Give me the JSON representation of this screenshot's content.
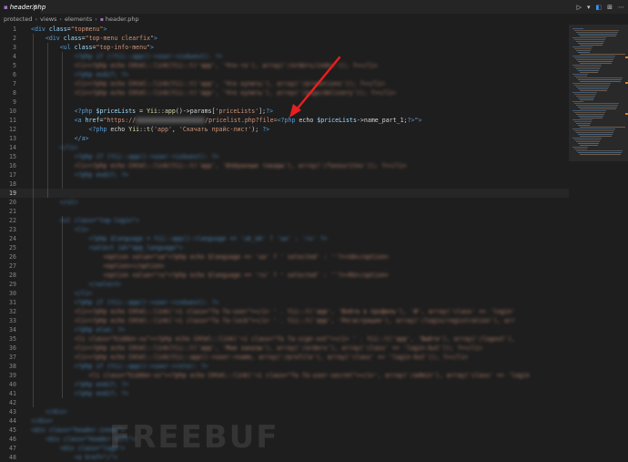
{
  "tab": {
    "icon": "php-elephant-icon",
    "title": "header.php",
    "close": "×"
  },
  "actions": [
    "▷",
    "▾",
    "◧",
    "⊞",
    "⋯"
  ],
  "breadcrumbs": {
    "items": [
      "protected",
      "views",
      "elements",
      "header.php"
    ],
    "separator": "›"
  },
  "lines": [
    {
      "n": "1",
      "code": [
        [
          "t-tag",
          "<div "
        ],
        [
          "t-attr",
          "class"
        ],
        [
          "t-plain",
          "="
        ],
        [
          "t-str",
          "\"topmenu\""
        ],
        [
          "t-tag",
          ">"
        ]
      ]
    },
    {
      "n": "2",
      "code": [
        [
          "t-plain",
          "    "
        ],
        [
          "t-tag",
          "<div "
        ],
        [
          "t-attr",
          "class"
        ],
        [
          "t-plain",
          "="
        ],
        [
          "t-str",
          "\"top-menu clearfix\""
        ],
        [
          "t-tag",
          ">"
        ]
      ]
    },
    {
      "n": "3",
      "code": [
        [
          "t-plain",
          "        "
        ],
        [
          "t-tag",
          "<ul "
        ],
        [
          "t-attr",
          "class"
        ],
        [
          "t-plain",
          "="
        ],
        [
          "t-str",
          "\"top-info-menu\""
        ],
        [
          "t-tag",
          ">"
        ]
      ]
    },
    {
      "n": "4",
      "blur": true,
      "code": [
        [
          "t-plain",
          "            "
        ],
        [
          "t-php",
          "<?php if (!Yii::app()->user->isGuest): ?>"
        ]
      ]
    },
    {
      "n": "5",
      "blur": true,
      "code": [
        [
          "t-plain",
          "            "
        ],
        [
          "t-str",
          "<li><?php echo CHtml::link(Yii::t('app', 'Что-то'), array('/orders/index')); ?></li>"
        ]
      ]
    },
    {
      "n": "6",
      "blur": true,
      "code": [
        [
          "t-plain",
          "            "
        ],
        [
          "t-php",
          "<?php endif; ?>"
        ]
      ]
    },
    {
      "n": "7",
      "blur": true,
      "code": [
        [
          "t-plain",
          "            "
        ],
        [
          "t-str",
          "<li><?php echo CHtml::link(Yii::t('app', 'Что купить'), array('/promotions')); ?></li>"
        ]
      ]
    },
    {
      "n": "8",
      "blur": true,
      "code": [
        [
          "t-plain",
          "            "
        ],
        [
          "t-str",
          "<li><?php echo CHtml::link(Yii::t('app', 'Что купить'), array('/page/delivery')); ?></li>"
        ]
      ]
    },
    {
      "n": "9",
      "code": []
    },
    {
      "n": "10",
      "code": [
        [
          "t-plain",
          "            "
        ],
        [
          "t-php",
          "<?php "
        ],
        [
          "t-var",
          "$priceLists"
        ],
        [
          "t-plain",
          " = "
        ],
        [
          "t-fn",
          "Yii"
        ],
        [
          "t-plain",
          "::"
        ],
        [
          "t-fn",
          "app"
        ],
        [
          "t-plain",
          "()->params["
        ],
        [
          "t-str",
          "'priceLists'"
        ],
        [
          "t-plain",
          "];"
        ],
        [
          "t-php",
          "?>"
        ]
      ]
    },
    {
      "n": "11",
      "code": [
        [
          "t-plain",
          "            "
        ],
        [
          "t-tag",
          "<a "
        ],
        [
          "t-attr",
          "href"
        ],
        [
          "t-plain",
          "="
        ],
        [
          "t-str",
          "\"https://"
        ],
        [
          "mask",
          "                       "
        ],
        [
          "t-str",
          "/pricelist.php?file="
        ],
        [
          "t-php",
          "<?php "
        ],
        [
          "t-plain",
          "echo "
        ],
        [
          "t-var",
          "$priceLists"
        ],
        [
          "t-plain",
          "->name_part_1;"
        ],
        [
          "t-php",
          "?>"
        ],
        [
          "t-str",
          "\""
        ],
        [
          "t-tag",
          ">"
        ]
      ]
    },
    {
      "n": "12",
      "code": [
        [
          "t-plain",
          "                "
        ],
        [
          "t-php",
          "<?php "
        ],
        [
          "t-plain",
          "echo "
        ],
        [
          "t-fn",
          "Yii"
        ],
        [
          "t-plain",
          "::"
        ],
        [
          "t-fn",
          "t"
        ],
        [
          "t-plain",
          "("
        ],
        [
          "t-str",
          "'app'"
        ],
        [
          "t-plain",
          ", "
        ],
        [
          "t-str",
          "'Скачать прайс-лист'"
        ],
        [
          "t-plain",
          "); "
        ],
        [
          "t-php",
          "?>"
        ]
      ]
    },
    {
      "n": "13",
      "code": [
        [
          "t-plain",
          "            "
        ],
        [
          "t-tag",
          "</a>"
        ]
      ]
    },
    {
      "n": "14",
      "blur": true,
      "code": [
        [
          "t-plain",
          "        "
        ],
        [
          "t-tag",
          "</li>"
        ]
      ]
    },
    {
      "n": "15",
      "blur": true,
      "code": [
        [
          "t-plain",
          "            "
        ],
        [
          "t-php",
          "<?php if (Yii::app()->user->isGuest): ?>"
        ]
      ]
    },
    {
      "n": "16",
      "blur": true,
      "code": [
        [
          "t-plain",
          "            "
        ],
        [
          "t-str",
          "<li><?php echo CHtml::link(Yii::t('app', 'Избранные товары'), array('/favourites')); ?></li>"
        ]
      ]
    },
    {
      "n": "17",
      "blur": true,
      "code": [
        [
          "t-plain",
          "            "
        ],
        [
          "t-php",
          "<?php endif; ?>"
        ]
      ]
    },
    {
      "n": "18",
      "code": []
    },
    {
      "n": "19",
      "active": true,
      "code": []
    },
    {
      "n": "20",
      "blur": true,
      "code": [
        [
          "t-plain",
          "        "
        ],
        [
          "t-tag",
          "</ul>"
        ]
      ]
    },
    {
      "n": "21",
      "code": []
    },
    {
      "n": "22",
      "blur": true,
      "code": [
        [
          "t-plain",
          "        "
        ],
        [
          "t-tag",
          "<ul class=\"top-login\">"
        ]
      ]
    },
    {
      "n": "23",
      "blur": true,
      "code": [
        [
          "t-plain",
          "            "
        ],
        [
          "t-tag",
          "<li>"
        ]
      ]
    },
    {
      "n": "24",
      "blur": true,
      "code": [
        [
          "t-plain",
          "                "
        ],
        [
          "t-php",
          "<?php $language = Yii::app()->language == 'uk_UA' ? 'ua' : 'ru' ?>"
        ]
      ]
    },
    {
      "n": "25",
      "blur": true,
      "code": [
        [
          "t-plain",
          "                "
        ],
        [
          "t-tag",
          "<select id=\"app_language\">"
        ]
      ]
    },
    {
      "n": "26",
      "blur": true,
      "code": [
        [
          "t-plain",
          "                    "
        ],
        [
          "t-str",
          "<option value=\"ua\"<?php echo $language == 'ua' ? ' selected' : ''?>>UA</option>"
        ]
      ]
    },
    {
      "n": "27",
      "blur": true,
      "code": [
        [
          "t-plain",
          "                    "
        ],
        [
          "t-str",
          "<option></option>"
        ]
      ]
    },
    {
      "n": "28",
      "blur": true,
      "code": [
        [
          "t-plain",
          "                    "
        ],
        [
          "t-str",
          "<option value=\"ru\"<?php echo $language == 'ru' ? ' selected' : ''?>>RU</option>"
        ]
      ]
    },
    {
      "n": "29",
      "blur": true,
      "code": [
        [
          "t-plain",
          "                "
        ],
        [
          "t-tag",
          "</select>"
        ]
      ]
    },
    {
      "n": "30",
      "blur": true,
      "code": [
        [
          "t-plain",
          "            "
        ],
        [
          "t-tag",
          "</li>"
        ]
      ]
    },
    {
      "n": "31",
      "blur": true,
      "code": [
        [
          "t-plain",
          "            "
        ],
        [
          "t-php",
          "<?php if (Yii::app()->user->isGuest): ?>"
        ]
      ]
    },
    {
      "n": "32",
      "blur": true,
      "code": [
        [
          "t-plain",
          "            "
        ],
        [
          "t-str",
          "<li><?php echo CHtml::link('<i class=\"fa fa-user\"></i> ' . Yii::t('app', 'Войти в профиль'), '#', array('class' => 'login'"
        ]
      ]
    },
    {
      "n": "33",
      "blur": true,
      "code": [
        [
          "t-plain",
          "            "
        ],
        [
          "t-str",
          "<li><?php echo CHtml::link('<i class=\"fa fa-lock\"></i> ' . Yii::t('app', 'Регистрация'), array('/login/registration'), arr"
        ]
      ]
    },
    {
      "n": "34",
      "blur": true,
      "code": [
        [
          "t-plain",
          "            "
        ],
        [
          "t-php",
          "<?php else: ?>"
        ]
      ]
    },
    {
      "n": "35",
      "blur": true,
      "code": [
        [
          "t-plain",
          "            "
        ],
        [
          "t-str",
          "<li class=\"hidden-xs\"><?php echo CHtml::link('<i class=\"fa fa-sign-out\"></i> ' . Yii::t('app', 'Выйти'), array('/logout'),"
        ]
      ]
    },
    {
      "n": "36",
      "blur": true,
      "code": [
        [
          "t-plain",
          "            "
        ],
        [
          "t-str",
          "<li><?php echo CHtml::link(Yii::t('app', 'Мои заказы'), array('/orders'), array('class' => 'login-but')); ?></li>"
        ]
      ]
    },
    {
      "n": "37",
      "blur": true,
      "code": [
        [
          "t-plain",
          "            "
        ],
        [
          "t-str",
          "<li><?php echo CHtml::link(Yii::app()->user->name, array('/profile'), array('class' => 'login-but')); ?></li>"
        ]
      ]
    },
    {
      "n": "38",
      "blur": true,
      "code": [
        [
          "t-plain",
          "            "
        ],
        [
          "t-php",
          "<?php if (Yii::app()->user->role): ?>"
        ]
      ]
    },
    {
      "n": "39",
      "blur": true,
      "code": [
        [
          "t-plain",
          "                "
        ],
        [
          "t-str",
          "<li class=\"hidden-xs\"><?php echo CHtml::link('<i class=\"fa fa-user-secret\"></i>', array('/admin'), array('class' => 'login"
        ]
      ]
    },
    {
      "n": "40",
      "blur": true,
      "code": [
        [
          "t-plain",
          "            "
        ],
        [
          "t-php",
          "<?php endif; ?>"
        ]
      ]
    },
    {
      "n": "41",
      "blur": true,
      "code": [
        [
          "t-plain",
          "            "
        ],
        [
          "t-php",
          "<?php endif; ?>"
        ]
      ]
    },
    {
      "n": "42",
      "code": []
    },
    {
      "n": "43",
      "blur": true,
      "code": [
        [
          "t-plain",
          "    "
        ],
        [
          "t-tag",
          "</div>"
        ]
      ]
    },
    {
      "n": "44",
      "blur": true,
      "code": [
        [
          "t-tag",
          "</div>"
        ]
      ]
    },
    {
      "n": "45",
      "blur": true,
      "code": [
        [
          "t-tag",
          "<div class=\"header-inner\">"
        ]
      ]
    },
    {
      "n": "46",
      "blur": true,
      "code": [
        [
          "t-plain",
          "    "
        ],
        [
          "t-tag",
          "<div class=\"header-left\">"
        ]
      ]
    },
    {
      "n": "47",
      "blur": true,
      "code": [
        [
          "t-plain",
          "        "
        ],
        [
          "t-tag",
          "<div class=\"logo\">"
        ]
      ]
    },
    {
      "n": "48",
      "blur": true,
      "code": [
        [
          "t-plain",
          "            "
        ],
        [
          "t-tag",
          "<a href=\"/\">"
        ]
      ]
    }
  ]
}
